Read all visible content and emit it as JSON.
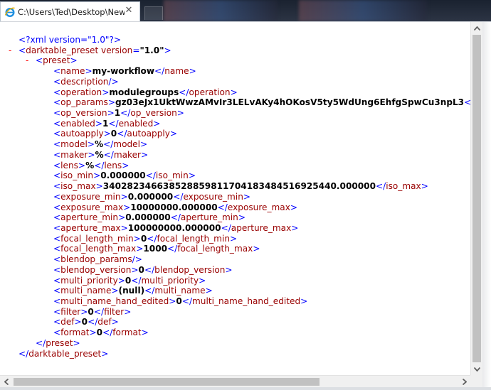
{
  "tab": {
    "title": "C:\\Users\\Ted\\Desktop\\New T...",
    "close": "✕",
    "icon": "ie-page-icon"
  },
  "scrollbar": {
    "up": "▲",
    "down": "▼",
    "left": "◀",
    "right": "▶"
  },
  "xml": {
    "pi": "<?xml version=\"1.0\"?>",
    "root_open": {
      "minus": "-",
      "name": "darktable_preset",
      "attr": "version",
      "value": "\"1.0\""
    },
    "preset_open": {
      "minus": "-",
      "name": "preset"
    },
    "fields": [
      {
        "tag": "name",
        "value": "my-workflow"
      },
      {
        "tag": "description",
        "value": "",
        "self_closing": true
      },
      {
        "tag": "operation",
        "value": "modulegroups"
      },
      {
        "tag": "op_params",
        "value": "gz03eJx1UktWwzAMvIr3LELvAKy4hOKosV5ty5WdUng6EhfgSpwCu3npL3"
      },
      {
        "tag": "op_version",
        "value": "1"
      },
      {
        "tag": "enabled",
        "value": "1"
      },
      {
        "tag": "autoapply",
        "value": "0"
      },
      {
        "tag": "model",
        "value": "%"
      },
      {
        "tag": "maker",
        "value": "%"
      },
      {
        "tag": "lens",
        "value": "%"
      },
      {
        "tag": "iso_min",
        "value": "0.000000"
      },
      {
        "tag": "iso_max",
        "value": "340282346638528859811704183484516925440.000000"
      },
      {
        "tag": "exposure_min",
        "value": "0.000000"
      },
      {
        "tag": "exposure_max",
        "value": "10000000.000000"
      },
      {
        "tag": "aperture_min",
        "value": "0.000000"
      },
      {
        "tag": "aperture_max",
        "value": "100000000.000000"
      },
      {
        "tag": "focal_length_min",
        "value": "0"
      },
      {
        "tag": "focal_length_max",
        "value": "1000"
      },
      {
        "tag": "blendop_params",
        "value": "",
        "self_closing": true
      },
      {
        "tag": "blendop_version",
        "value": "0"
      },
      {
        "tag": "multi_priority",
        "value": "0"
      },
      {
        "tag": "multi_name",
        "value": "(null)"
      },
      {
        "tag": "multi_name_hand_edited",
        "value": "0"
      },
      {
        "tag": "filter",
        "value": "0"
      },
      {
        "tag": "def",
        "value": "0"
      },
      {
        "tag": "format",
        "value": "0"
      }
    ],
    "preset_close": "preset",
    "root_close": "darktable_preset"
  },
  "colors": {
    "markup": "#0000ff",
    "tag": "#990000",
    "collapse": "#ff0000",
    "text": "#000000"
  }
}
